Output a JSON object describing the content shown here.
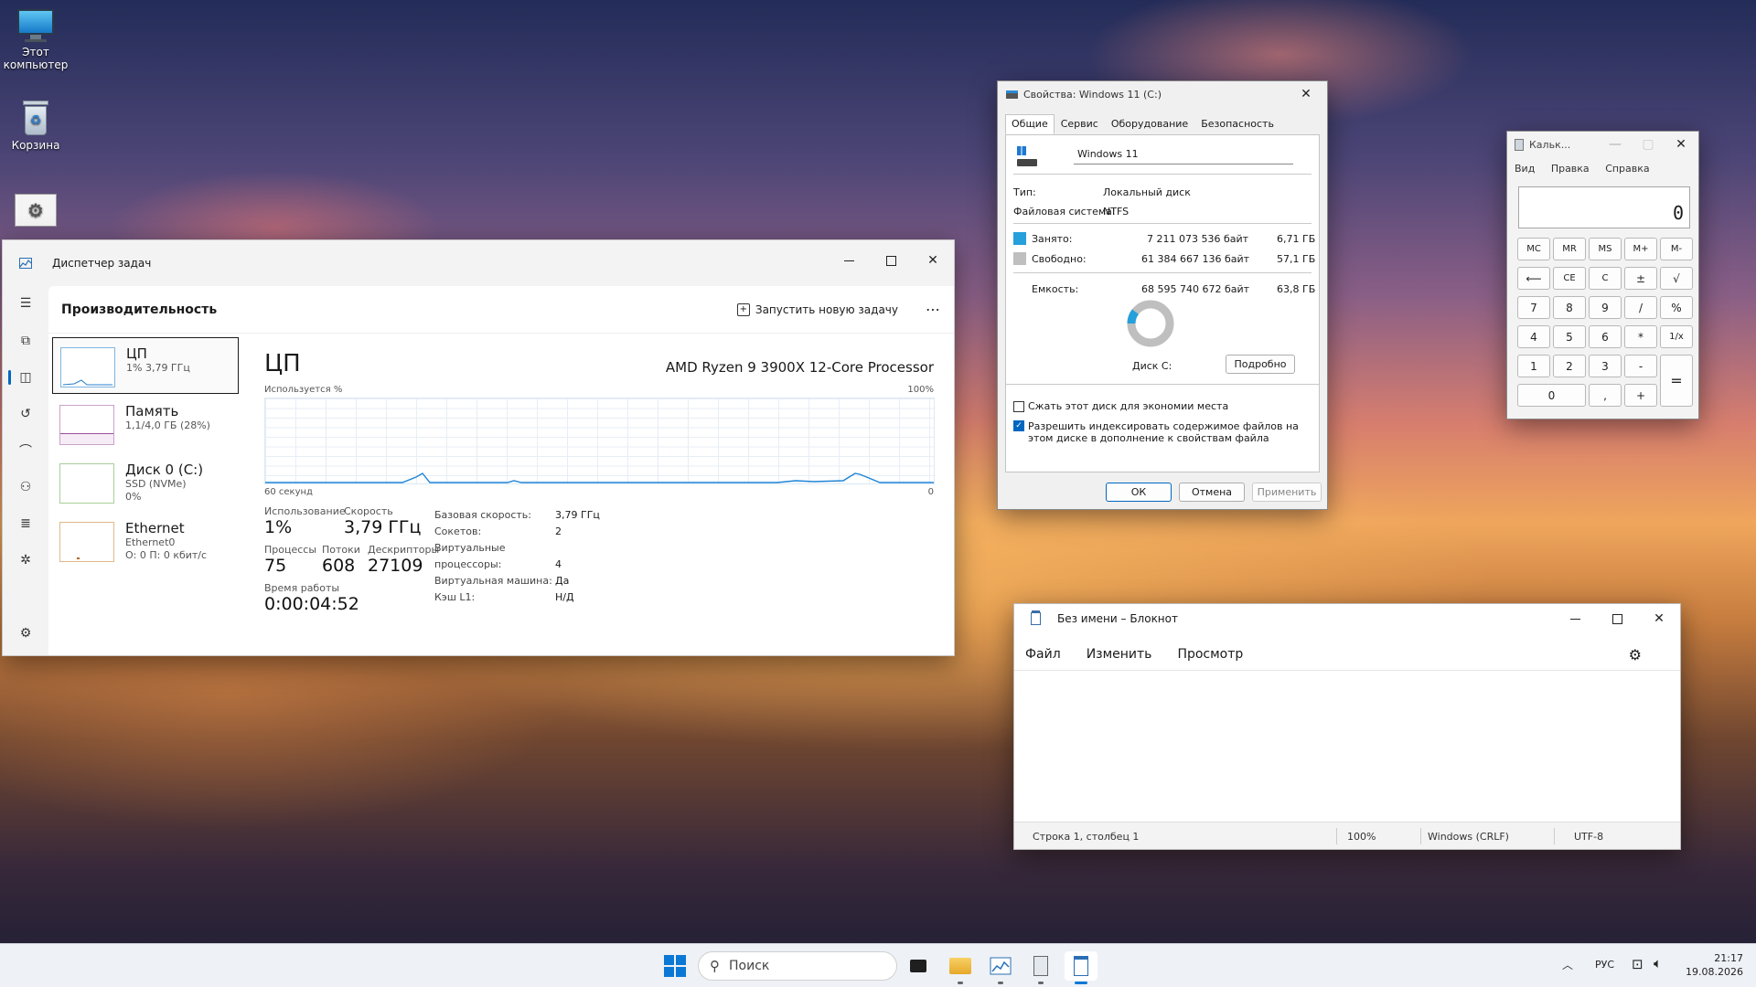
{
  "desktop": {
    "icons": [
      {
        "label": "Этот компьютер"
      },
      {
        "label": "Корзина"
      }
    ]
  },
  "taskmgr": {
    "title": "Диспетчер задач",
    "page_title": "Производительность",
    "run_task_label": "Запустить новую задачу",
    "more_label": "⋯",
    "list": [
      {
        "name": "ЦП",
        "sub1": "1% 3,79 ГГц",
        "sub2": ""
      },
      {
        "name": "Память",
        "sub1": "1,1/4,0 ГБ (28%)",
        "sub2": ""
      },
      {
        "name": "Диск 0 (C:)",
        "sub1": "SSD (NVMe)",
        "sub2": "0%"
      },
      {
        "name": "Ethernet",
        "sub1": "Ethernet0",
        "sub2": "О: 0 П: 0 кбит/с"
      }
    ],
    "cpu": {
      "heading": "ЦП",
      "model": "AMD Ryzen 9 3900X 12-Core Processor",
      "graph_label": "Используется %",
      "graph_max": "100%",
      "graph_time": "60 секунд",
      "graph_min": "0",
      "usage_label": "Использование",
      "usage_value": "1%",
      "speed_label": "Скорость",
      "speed_value": "3,79 ГГц",
      "proc_label": "Процессы",
      "proc_value": "75",
      "threads_label": "Потоки",
      "threads_value": "608",
      "handles_label": "Дескрипторы",
      "handles_value": "27109",
      "uptime_label": "Время работы",
      "uptime_value": "0:00:04:52",
      "details": [
        {
          "k": "Базовая скорость:",
          "v": "3,79 ГГц"
        },
        {
          "k": "Сокетов:",
          "v": "2"
        },
        {
          "k": "Виртуальные процессоры:",
          "v": "4"
        },
        {
          "k": "Виртуальная машина:",
          "v": "Да"
        },
        {
          "k": "Кэш L1:",
          "v": "Н/Д"
        }
      ]
    }
  },
  "props": {
    "title": "Свойства: Windows 11 (C:)",
    "tabs": [
      "Общие",
      "Сервис",
      "Оборудование",
      "Безопасность"
    ],
    "name": "Windows 11",
    "type_label": "Тип:",
    "type_value": "Локальный диск",
    "fs_label": "Файловая система:",
    "fs_value": "NTFS",
    "used_label": "Занято:",
    "used_bytes": "7 211 073 536 байт",
    "used_gb": "6,71 ГБ",
    "free_label": "Свободно:",
    "free_bytes": "61 384 667 136 байт",
    "free_gb": "57,1 ГБ",
    "cap_label": "Емкость:",
    "cap_bytes": "68 595 740 672 байт",
    "cap_gb": "63,8 ГБ",
    "disk_label": "Диск C:",
    "details_button": "Подробно",
    "compress_label": "Сжать этот диск для экономии места",
    "index_label": "Разрешить индексировать содержимое файлов на этом диске в дополнение к свойствам файла",
    "ok": "ОК",
    "cancel": "Отмена",
    "apply": "Применить",
    "used_fraction": 0.105,
    "used_color": "#26a0da",
    "free_color": "#bfbfbf"
  },
  "calc": {
    "title": "Кальк...",
    "menu": [
      "Вид",
      "Правка",
      "Справка"
    ],
    "display": "0",
    "keys": {
      "mc": "MC",
      "mr": "MR",
      "ms": "MS",
      "mplus": "M+",
      "mminus": "M-",
      "back": "⟵",
      "ce": "CE",
      "c": "C",
      "pm": "±",
      "sqrt": "√",
      "k7": "7",
      "k8": "8",
      "k9": "9",
      "div": "/",
      "pct": "%",
      "k4": "4",
      "k5": "5",
      "k6": "6",
      "mul": "*",
      "inv": "1/x",
      "k1": "1",
      "k2": "2",
      "k3": "3",
      "sub": "-",
      "eq": "=",
      "k0": "0",
      "dot": ",",
      "add": "+"
    }
  },
  "notepad": {
    "title": "Без имени – Блокнот",
    "menu": [
      "Файл",
      "Изменить",
      "Просмотр"
    ],
    "status_pos": "Строка 1, столбец 1",
    "status_zoom": "100%",
    "status_eol": "Windows (CRLF)",
    "status_enc": "UTF-8"
  },
  "taskbar": {
    "search_placeholder": "Поиск",
    "lang": "РУС",
    "time": "21:17",
    "date": "19.08.2026"
  }
}
